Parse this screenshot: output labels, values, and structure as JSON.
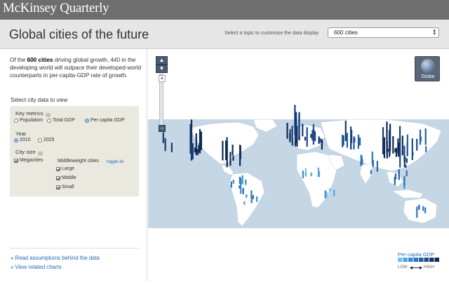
{
  "brand": "McKinsey Quarterly",
  "page_title": "Global cities of the future",
  "topic": {
    "label": "Select a topic to customize the data display",
    "selected": "600 cities"
  },
  "intro": {
    "pre": "Of the ",
    "bold": "600 cities",
    "post": " driving global growth, 440 in the developing world will outpace their developed-world counterparts in per-capita-GDP rate of growth."
  },
  "select_title": "Select city data to view",
  "key_metrics": {
    "label": "Key metrics",
    "options": [
      "Population",
      "Total GDP",
      "Per capita GDP"
    ],
    "selected": "Per capita GDP"
  },
  "year": {
    "label": "Year",
    "options": [
      "2010",
      "2025"
    ],
    "selected": "2010"
  },
  "city_size": {
    "label": "City size",
    "megacities": "Megacities",
    "middleweight_label": "Middleweight cities",
    "toggle_all": "toggle all",
    "middleweight_options": [
      "Large",
      "Middle",
      "Small"
    ]
  },
  "links": {
    "assumptions": "» Read assumptions behind the data",
    "related": "» View related charts"
  },
  "map_controls": {
    "zoom_in": "+",
    "zoom_out": "−",
    "globe": "Globe"
  },
  "legend": {
    "title": "Per capita GDP",
    "low": "LOW",
    "high": "HIGH",
    "colors": [
      "#6fc4ee",
      "#4aa6de",
      "#3a8ccf",
      "#2e74be",
      "#255fa6",
      "#1d4a8a",
      "#163a70",
      "#0f2a55"
    ]
  },
  "colors": {
    "ocean": "#c5d6e4",
    "land": "#ffffff",
    "accent": "#2a6bb8"
  }
}
